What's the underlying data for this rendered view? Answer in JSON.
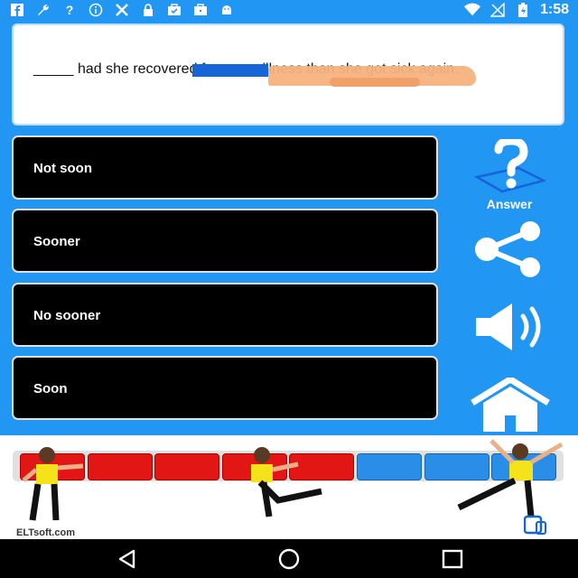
{
  "status_bar": {
    "time": "1:58",
    "left_icons": [
      "facebook-icon",
      "wrench-icon",
      "help-icon",
      "info-icon",
      "tools-icon",
      "lock-icon",
      "briefcase-check-icon",
      "briefcase-icon",
      "android-icon"
    ],
    "right_icons": [
      "wifi-icon",
      "signal-off-icon",
      "battery-charging-icon"
    ]
  },
  "question": {
    "text": "_____ had she recovered from one illness than she got sick again."
  },
  "options": [
    {
      "label": "Not soon"
    },
    {
      "label": "Sooner"
    },
    {
      "label": "No sooner"
    },
    {
      "label": "Soon"
    }
  ],
  "side": {
    "answer_label": "Answer"
  },
  "progress": {
    "segments": [
      "red",
      "red",
      "red",
      "red",
      "red",
      "blue",
      "blue",
      "blue"
    ],
    "answered_wrong": 5,
    "total": 8
  },
  "banner": {
    "brand": "ELTsoft.com",
    "logo_text": "ELT SOFT"
  },
  "colors": {
    "background": "#2196f3",
    "option_bg": "#000000",
    "wrong": "#e31616",
    "pending": "#2a8ee8"
  }
}
